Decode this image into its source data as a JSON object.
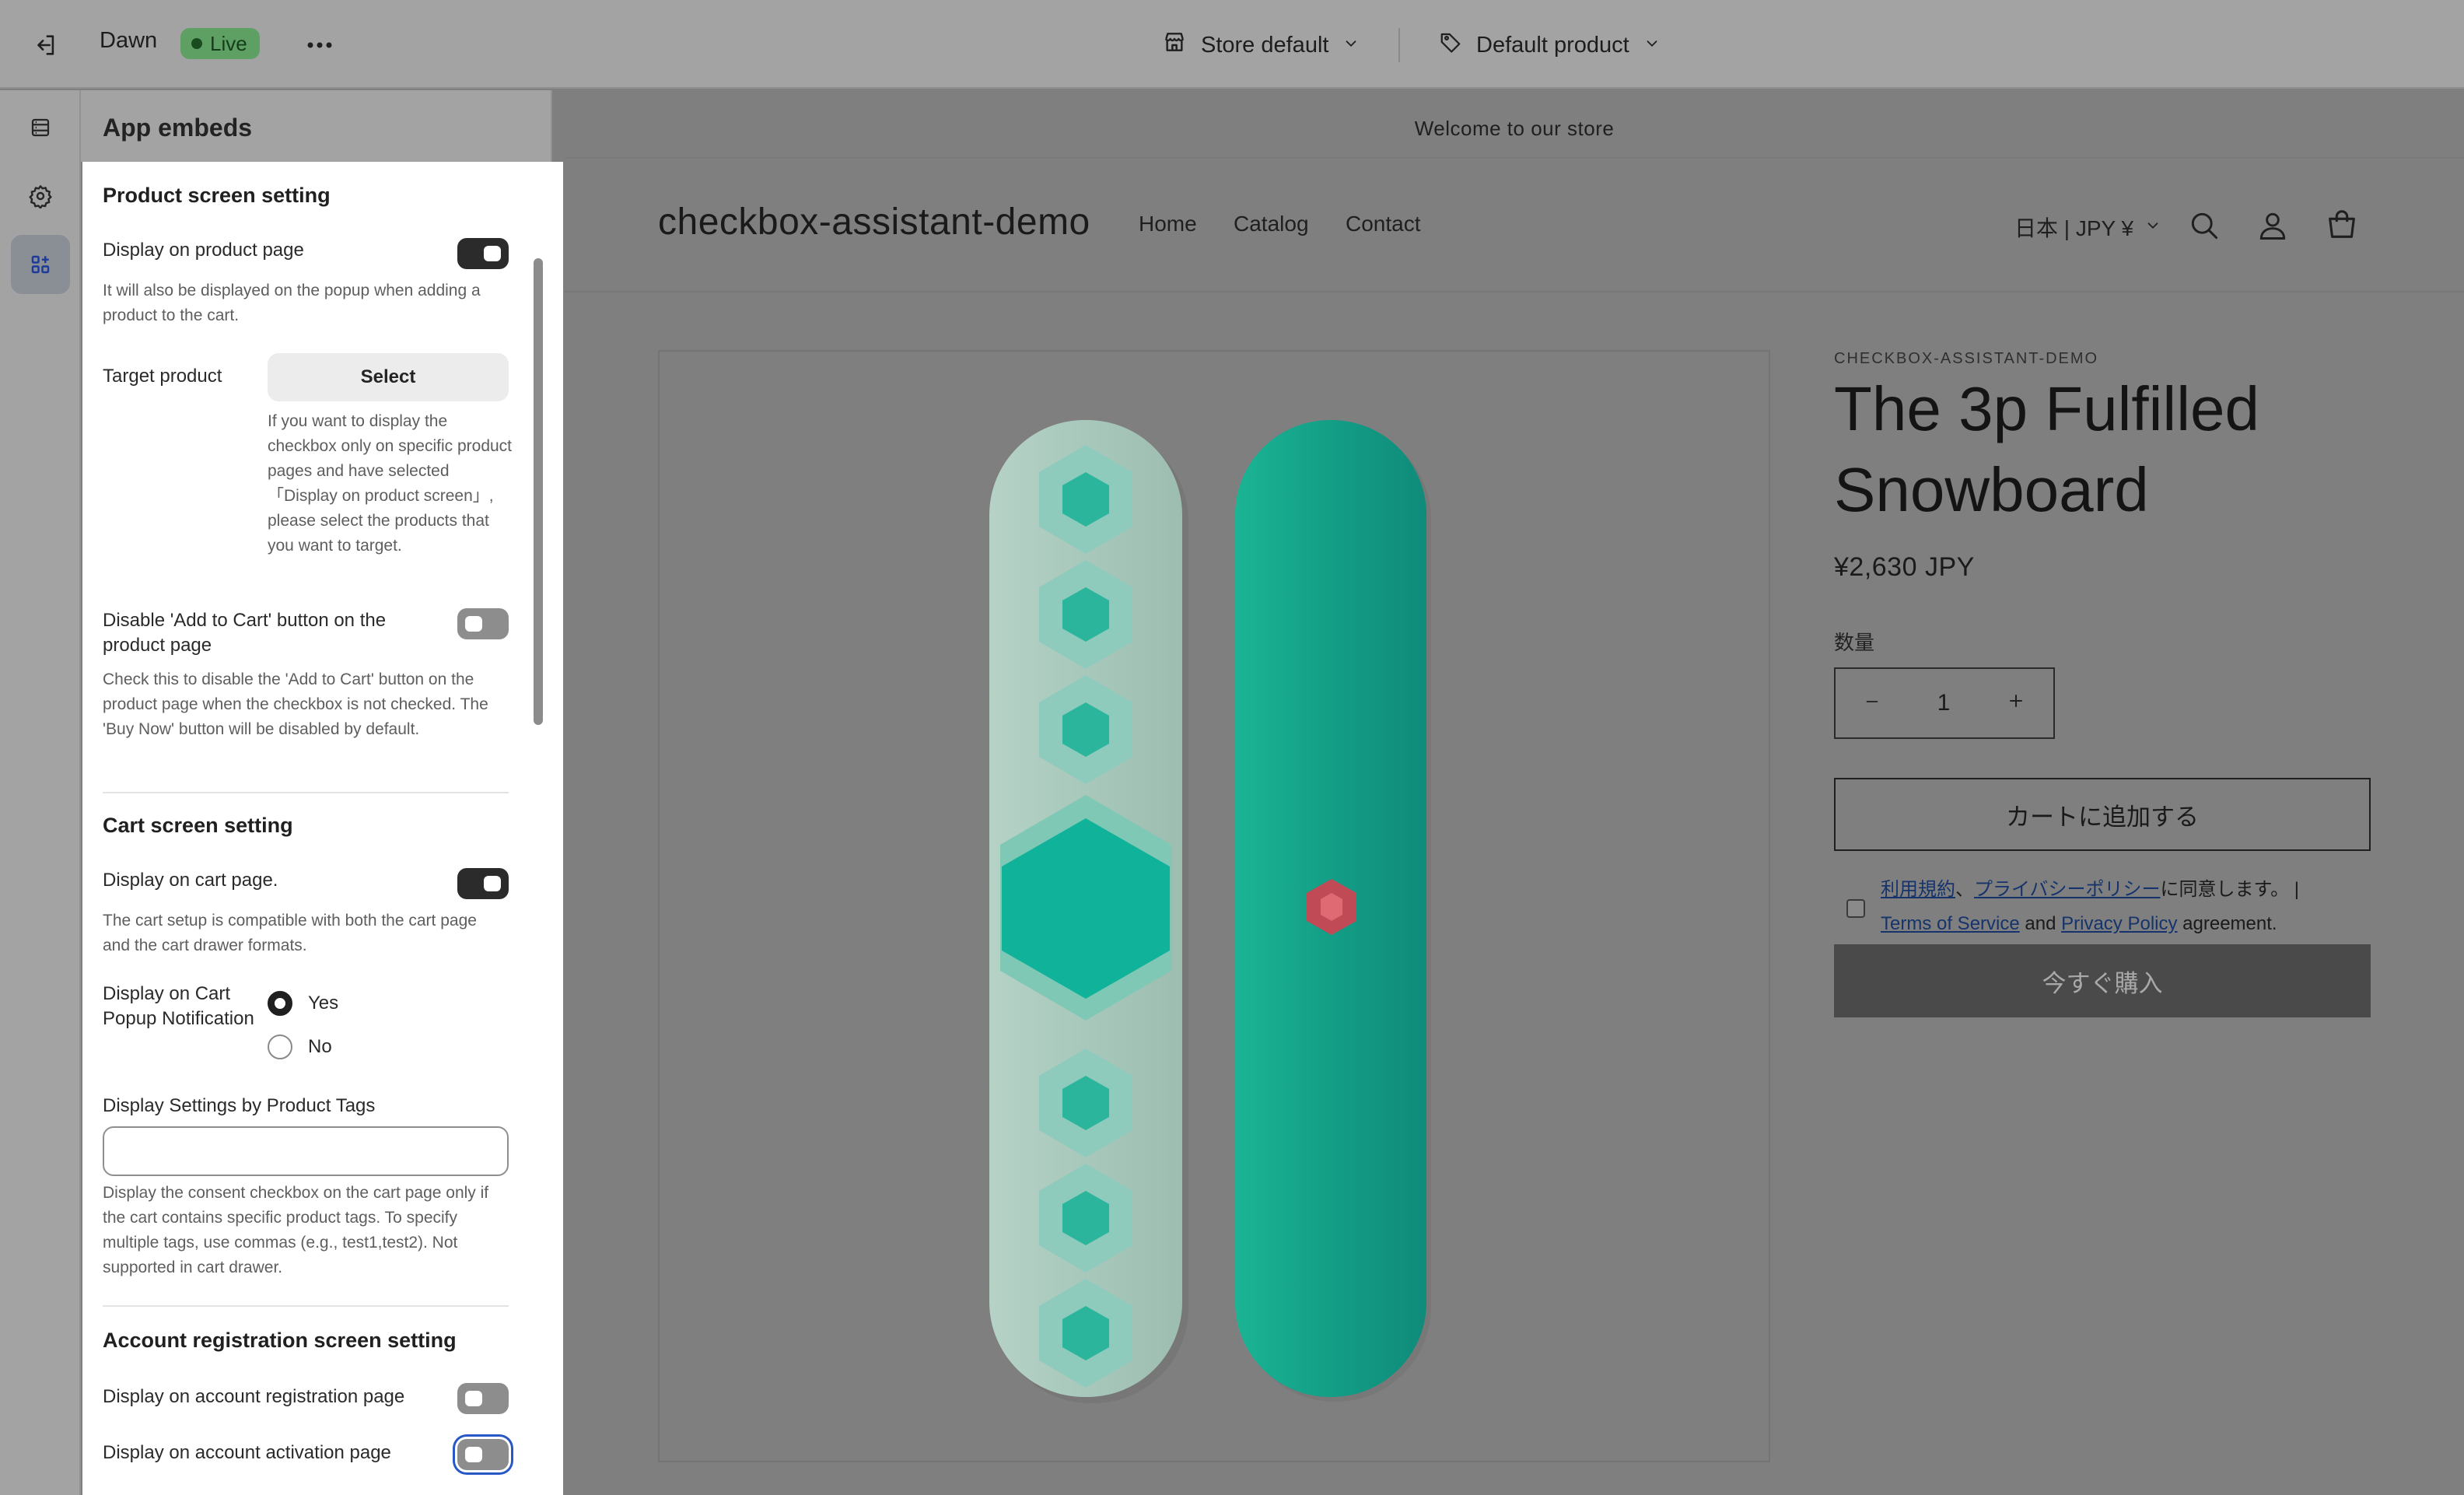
{
  "topbar": {
    "theme_name": "Dawn",
    "status_badge": "Live",
    "store_select": "Store default",
    "product_select": "Default product"
  },
  "sidebar": {
    "panel_title": "App embeds"
  },
  "product_section": {
    "title": "Product screen setting",
    "display_on_product_label": "Display on product page",
    "display_on_product_on": true,
    "display_on_product_help": "It will also be displayed on the popup when adding a product to the cart.",
    "target_product_label": "Target product",
    "select_button": "Select",
    "target_help": "If you want to display the checkbox only on specific product pages and have selected 「Display on product screen」, please select the products that you want to target.",
    "disable_add_to_cart_label": "Disable 'Add to Cart' button on the product page",
    "disable_add_to_cart_on": false,
    "disable_add_to_cart_help": "Check this to disable the 'Add to Cart' button on the product page when the checkbox is not checked. The 'Buy Now' button will be disabled by default."
  },
  "cart_section": {
    "title": "Cart screen setting",
    "display_on_cart_label": "Display on cart page.",
    "display_on_cart_on": true,
    "display_on_cart_help": "The cart setup is compatible with both the cart page and the cart drawer formats.",
    "popup_label": "Display on Cart Popup Notification",
    "option_yes": "Yes",
    "option_no": "No",
    "selected_option": "Yes",
    "tags_label": "Display Settings by Product Tags",
    "tags_value": "",
    "tags_help": "Display the consent checkbox on the cart page only if the cart contains specific product tags. To specify multiple tags, use commas (e.g., test1,test2). Not supported in cart drawer."
  },
  "account_section": {
    "title": "Account registration screen setting",
    "registration_label": "Display on account registration page",
    "registration_on": false,
    "activation_label": "Display on account activation page",
    "activation_on": false
  },
  "preview": {
    "announcement": "Welcome to our store",
    "store_name": "checkbox-assistant-demo",
    "nav": [
      "Home",
      "Catalog",
      "Contact"
    ],
    "locale": "日本 | JPY ¥",
    "vendor": "CHECKBOX-ASSISTANT-DEMO",
    "product_title": "The 3p Fulfilled Snowboard",
    "price": "¥2,630 JPY",
    "quantity_label": "数量",
    "quantity": "1",
    "add_to_cart": "カートに追加する",
    "consent": {
      "link_terms_ja": "利用規約",
      "sep1": "、",
      "link_privacy_ja": "プライバシーポリシー",
      "text_ja": "に同意します。 |",
      "link_terms_en": "Terms of Service",
      "and": " and ",
      "link_privacy_en": "Privacy Policy",
      "text_en": " agreement."
    },
    "buy_now": "今すぐ購入"
  },
  "colors": {
    "live_badge": "#5e9f63",
    "toggle_on": "#2b2b2b",
    "board_left": "#a9c9bd",
    "board_right": "#13a08a",
    "buy_now_bg": "#4a4a4a"
  }
}
